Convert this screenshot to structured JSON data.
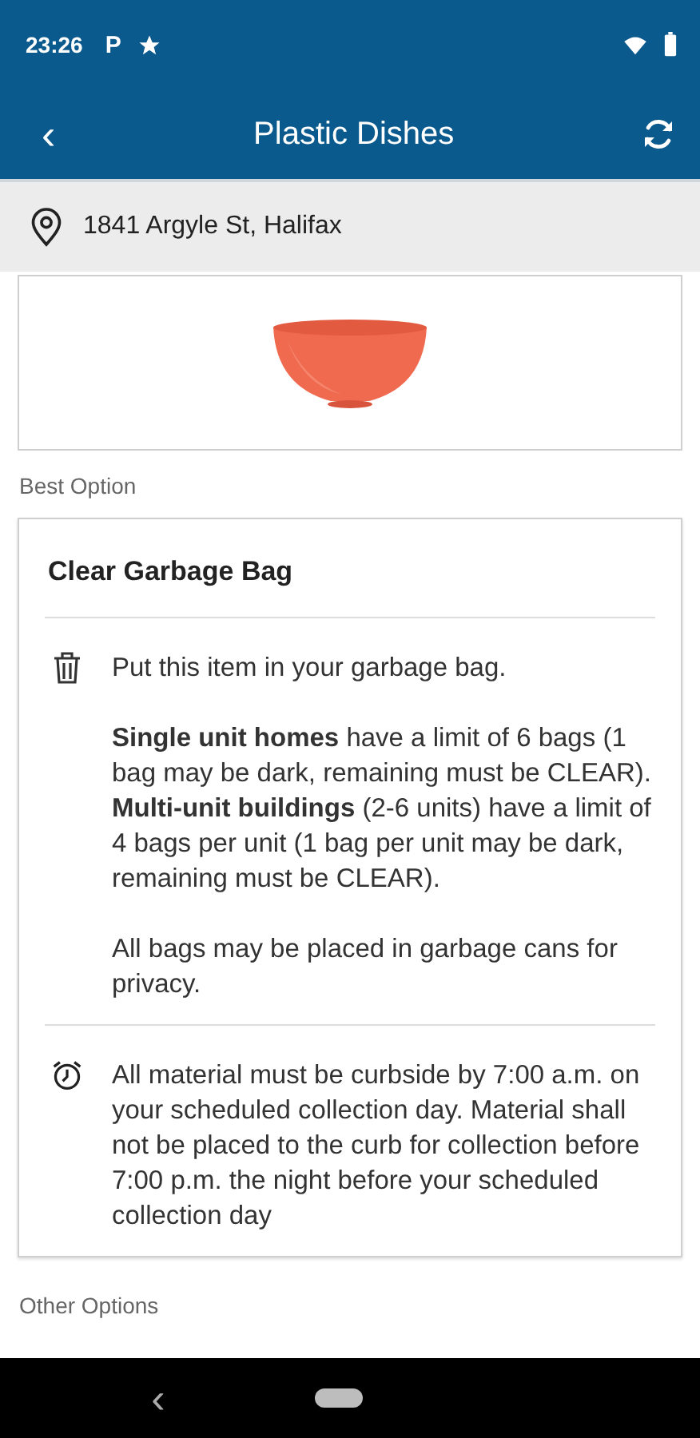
{
  "status_bar": {
    "time": "23:26",
    "notification": "P"
  },
  "app_bar": {
    "back": "‹",
    "title": "Plastic Dishes"
  },
  "location": {
    "address": "1841 Argyle St, Halifax"
  },
  "best_option": {
    "heading": "Best Option",
    "title": "Clear Garbage Bag",
    "sections": [
      {
        "kind": "trash",
        "paragraphs": [
          "Put this item in your garbage bag.",
          "**Single unit homes** have a limit of 6 bags (1 bag may be dark, remaining must be CLEAR). **Multi-unit buildings** (2-6 units) have a limit of 4 bags per unit (1 bag per unit may be dark, remaining must be CLEAR).",
          "All bags may be placed in garbage cans for privacy."
        ]
      },
      {
        "kind": "alarm",
        "paragraphs": [
          "All material must be curbside by 7:00 a.m. on your scheduled collection day. Material shall not be placed to the curb for collection before 7:00 p.m. the night before your scheduled collection day"
        ]
      }
    ]
  },
  "other_options": {
    "heading": "Other Options"
  },
  "nav_bar": {
    "back": "‹"
  }
}
